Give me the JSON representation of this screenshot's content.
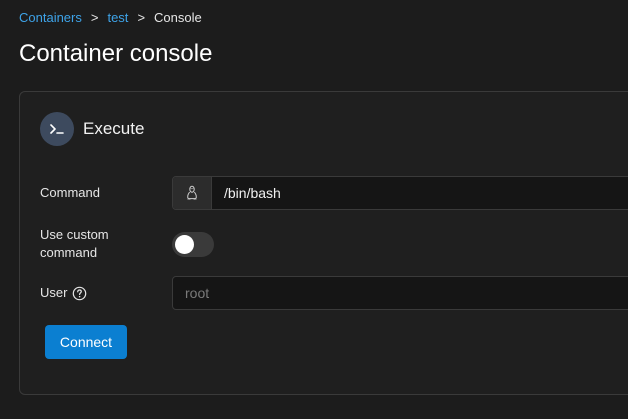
{
  "breadcrumb": {
    "items": [
      {
        "label": "Containers"
      },
      {
        "label": "test"
      }
    ],
    "separator": ">",
    "current": "Console"
  },
  "page": {
    "title": "Container console"
  },
  "card": {
    "title": "Execute",
    "icon": "terminal-icon"
  },
  "form": {
    "command": {
      "label": "Command",
      "addon_icon": "linux-icon",
      "value": "/bin/bash"
    },
    "custom_command": {
      "label_line1": "Use custom",
      "label_line2": "command",
      "enabled": false
    },
    "user": {
      "label": "User",
      "help_icon": "question-circle-icon",
      "placeholder": "root"
    },
    "connect_label": "Connect"
  },
  "colors": {
    "background": "#1c1c1c",
    "card": "#1f1f1f",
    "link": "#3ea3e8",
    "primary_button": "#0b7fd1",
    "badge": "#3d4a5e"
  }
}
